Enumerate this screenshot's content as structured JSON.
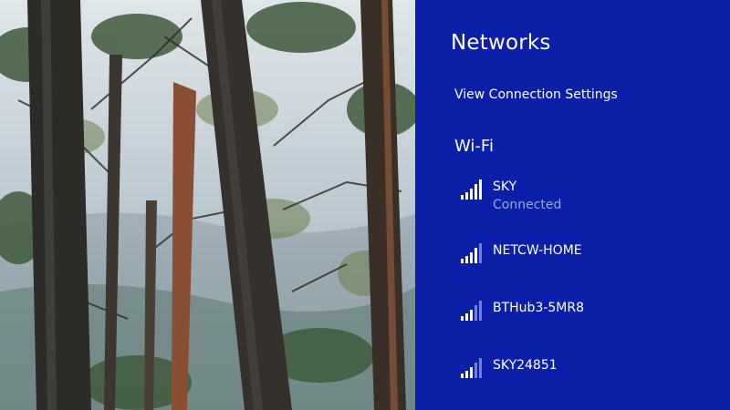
{
  "panel": {
    "title": "Networks",
    "settings_link": "View Connection Settings",
    "section_heading": "Wi-Fi",
    "background": "#0b1fa8"
  },
  "networks": [
    {
      "ssid": "SKY",
      "status": "Connected",
      "signal_bars": 5,
      "icon": "wifi-signal-icon"
    },
    {
      "ssid": "NETCW-HOME",
      "status": "",
      "signal_bars": 4,
      "icon": "wifi-signal-icon"
    },
    {
      "ssid": "BTHub3-5MR8",
      "status": "",
      "signal_bars": 3,
      "icon": "wifi-signal-icon"
    },
    {
      "ssid": "SKY24851",
      "status": "",
      "signal_bars": 3,
      "icon": "wifi-signal-icon"
    }
  ]
}
